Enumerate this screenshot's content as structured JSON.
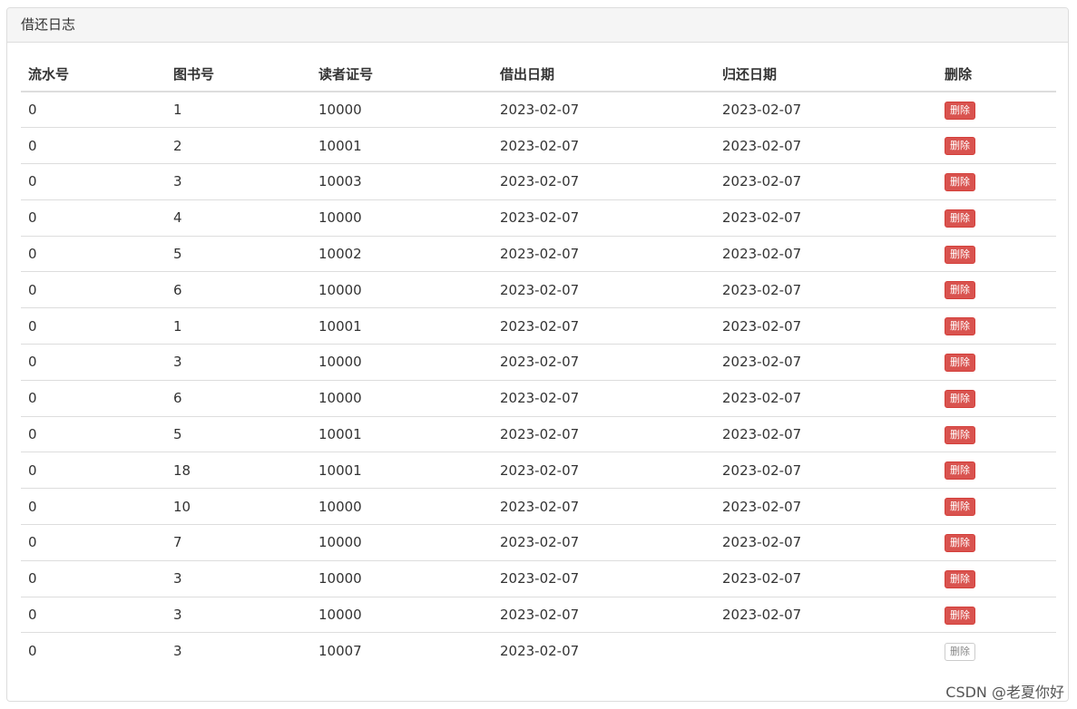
{
  "panel": {
    "title": "借还日志"
  },
  "table": {
    "headers": [
      "流水号",
      "图书号",
      "读者证号",
      "借出日期",
      "归还日期",
      "删除"
    ],
    "rows": [
      {
        "serial": "0",
        "book_id": "1",
        "reader_id": "10000",
        "lend_date": "2023-02-07",
        "return_date": "2023-02-07",
        "action": "删除",
        "action_state": "danger"
      },
      {
        "serial": "0",
        "book_id": "2",
        "reader_id": "10001",
        "lend_date": "2023-02-07",
        "return_date": "2023-02-07",
        "action": "删除",
        "action_state": "danger"
      },
      {
        "serial": "0",
        "book_id": "3",
        "reader_id": "10003",
        "lend_date": "2023-02-07",
        "return_date": "2023-02-07",
        "action": "删除",
        "action_state": "danger"
      },
      {
        "serial": "0",
        "book_id": "4",
        "reader_id": "10000",
        "lend_date": "2023-02-07",
        "return_date": "2023-02-07",
        "action": "删除",
        "action_state": "danger"
      },
      {
        "serial": "0",
        "book_id": "5",
        "reader_id": "10002",
        "lend_date": "2023-02-07",
        "return_date": "2023-02-07",
        "action": "删除",
        "action_state": "danger"
      },
      {
        "serial": "0",
        "book_id": "6",
        "reader_id": "10000",
        "lend_date": "2023-02-07",
        "return_date": "2023-02-07",
        "action": "删除",
        "action_state": "danger"
      },
      {
        "serial": "0",
        "book_id": "1",
        "reader_id": "10001",
        "lend_date": "2023-02-07",
        "return_date": "2023-02-07",
        "action": "删除",
        "action_state": "danger"
      },
      {
        "serial": "0",
        "book_id": "3",
        "reader_id": "10000",
        "lend_date": "2023-02-07",
        "return_date": "2023-02-07",
        "action": "删除",
        "action_state": "danger"
      },
      {
        "serial": "0",
        "book_id": "6",
        "reader_id": "10000",
        "lend_date": "2023-02-07",
        "return_date": "2023-02-07",
        "action": "删除",
        "action_state": "danger"
      },
      {
        "serial": "0",
        "book_id": "5",
        "reader_id": "10001",
        "lend_date": "2023-02-07",
        "return_date": "2023-02-07",
        "action": "删除",
        "action_state": "danger"
      },
      {
        "serial": "0",
        "book_id": "18",
        "reader_id": "10001",
        "lend_date": "2023-02-07",
        "return_date": "2023-02-07",
        "action": "删除",
        "action_state": "danger"
      },
      {
        "serial": "0",
        "book_id": "10",
        "reader_id": "10000",
        "lend_date": "2023-02-07",
        "return_date": "2023-02-07",
        "action": "删除",
        "action_state": "danger"
      },
      {
        "serial": "0",
        "book_id": "7",
        "reader_id": "10000",
        "lend_date": "2023-02-07",
        "return_date": "2023-02-07",
        "action": "删除",
        "action_state": "danger"
      },
      {
        "serial": "0",
        "book_id": "3",
        "reader_id": "10000",
        "lend_date": "2023-02-07",
        "return_date": "2023-02-07",
        "action": "删除",
        "action_state": "danger"
      },
      {
        "serial": "0",
        "book_id": "3",
        "reader_id": "10000",
        "lend_date": "2023-02-07",
        "return_date": "2023-02-07",
        "action": "删除",
        "action_state": "danger"
      },
      {
        "serial": "0",
        "book_id": "3",
        "reader_id": "10007",
        "lend_date": "2023-02-07",
        "return_date": "",
        "action": "删除",
        "action_state": "default"
      }
    ]
  },
  "colors": {
    "danger": "#d9534f",
    "panel_heading_bg": "#f5f5f5",
    "border": "#dddddd"
  },
  "watermark": "CSDN @老夏你好"
}
